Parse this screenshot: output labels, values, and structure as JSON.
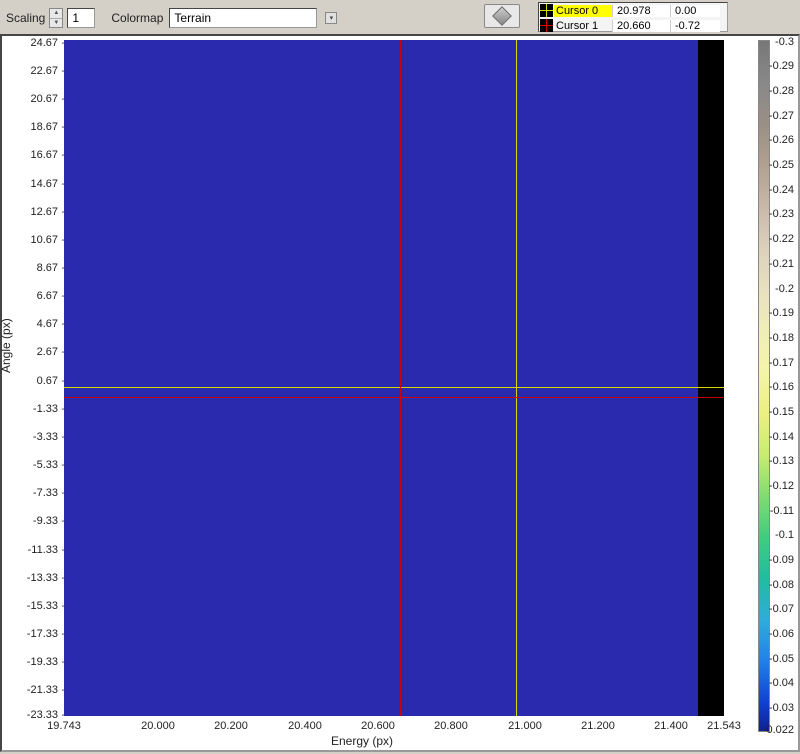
{
  "toolbar": {
    "scaling_label": "Scaling",
    "scaling_value": "1",
    "colormap_label": "Colormap",
    "colormap_value": "Terrain"
  },
  "cursors": [
    {
      "name": "Cursor 0",
      "x": "20.978",
      "y": "0.00",
      "color": "#d6d600",
      "highlight": true
    },
    {
      "name": "Cursor 1",
      "x": "20.660",
      "y": "-0.72",
      "color": "#cc0000",
      "highlight": false
    }
  ],
  "axes": {
    "ylabel": "Angle (px)",
    "xlabel": "Energy (px)",
    "y_ticks": [
      "24.67",
      "22.67",
      "20.67",
      "18.67",
      "16.67",
      "14.67",
      "12.67",
      "10.67",
      "8.67",
      "6.67",
      "4.67",
      "2.67",
      "0.67",
      "-1.33",
      "-3.33",
      "-5.33",
      "-7.33",
      "-9.33",
      "-11.33",
      "-13.33",
      "-15.33",
      "-17.33",
      "-19.33",
      "-21.33",
      "-23.33"
    ],
    "x_ticks": [
      "19.743",
      "20.000",
      "20.200",
      "20.400",
      "20.600",
      "20.800",
      "21.000",
      "21.200",
      "21.400",
      "21.543"
    ]
  },
  "colorbar_ticks": [
    "-0.3",
    "-0.29",
    "-0.28",
    "-0.27",
    "-0.26",
    "-0.25",
    "-0.24",
    "-0.23",
    "-0.22",
    "-0.21",
    "-0.2",
    "-0.19",
    "-0.18",
    "-0.17",
    "-0.16",
    "-0.15",
    "-0.14",
    "-0.13",
    "-0.12",
    "-0.11",
    "-0.1",
    "-0.09",
    "-0.08",
    "-0.07",
    "-0.06",
    "-0.05",
    "-0.04",
    "-0.03",
    "-0.022"
  ],
  "chart_data": {
    "type": "heatmap",
    "title": "",
    "xlabel": "Energy (px)",
    "ylabel": "Angle (px)",
    "xlim": [
      19.743,
      21.543
    ],
    "ylim": [
      -23.33,
      24.67
    ],
    "zlim": [
      -0.3,
      -0.022
    ],
    "colormap": "Terrain",
    "note": "Displayed region is uniform low-value (near zlim min). Black band at right edge is outside data extent.",
    "cursors": [
      {
        "name": "Cursor 0",
        "x": 20.978,
        "y": 0.0
      },
      {
        "name": "Cursor 1",
        "x": 20.66,
        "y": -0.72
      }
    ]
  }
}
